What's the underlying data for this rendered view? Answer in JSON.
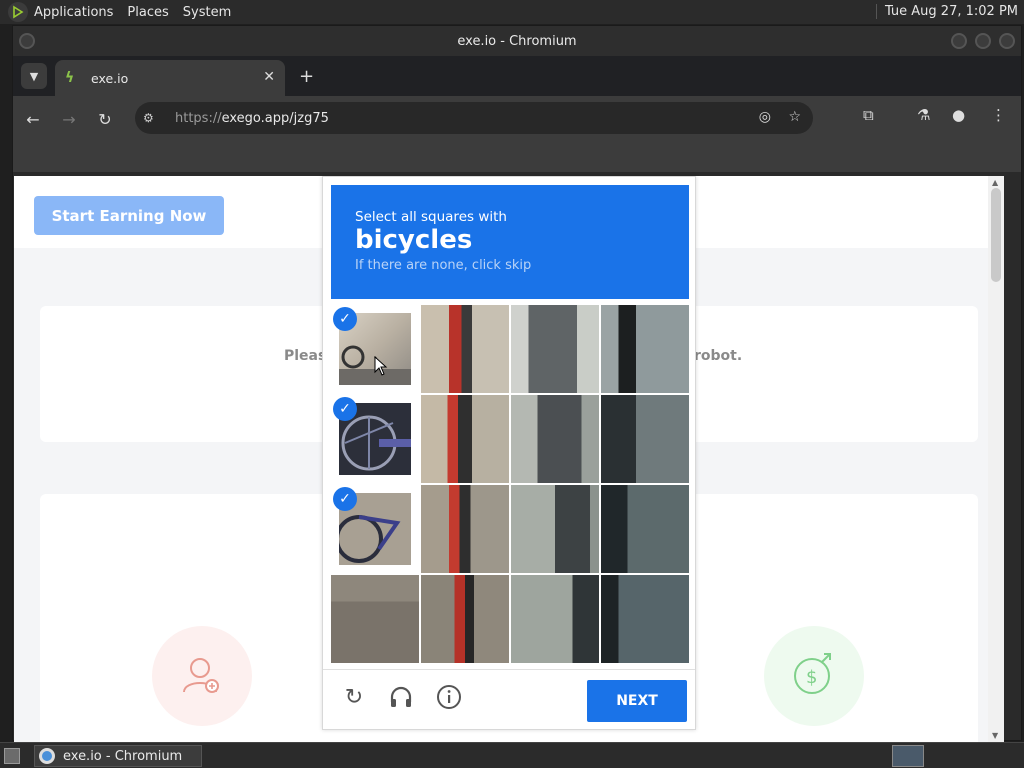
{
  "top_panel": {
    "menus": [
      "Applications",
      "Places",
      "System"
    ],
    "clock": "Tue Aug 27,  1:02 PM"
  },
  "window": {
    "title": "exe.io - Chromium"
  },
  "browser": {
    "tab_title": "exe.io",
    "new_tab_label": "+",
    "url_scheme": "https://",
    "url_rest": "exego.app/jzg75"
  },
  "page": {
    "start_button": "Start Earning Now",
    "card_text_left": "Pleas",
    "card_text_right": "robot."
  },
  "captcha": {
    "line1": "Select all squares with",
    "keyword": "bicycles",
    "line3": "If there are none, click skip",
    "next_label": "NEXT",
    "selected_tiles": [
      0,
      4,
      8
    ],
    "accent_color": "#1a73e8"
  },
  "taskbar": {
    "item_label": "exe.io - Chromium"
  }
}
